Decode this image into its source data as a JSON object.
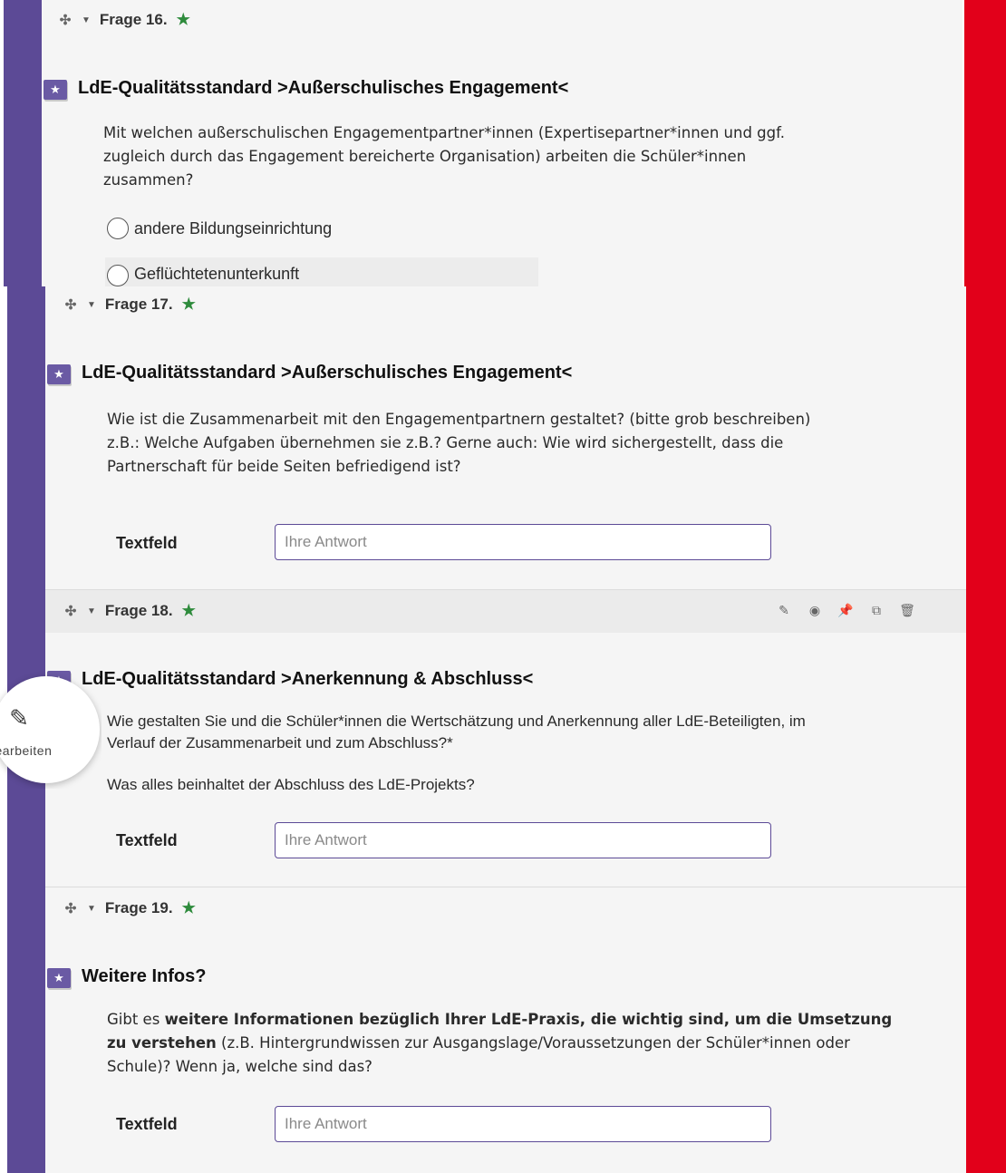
{
  "colors": {
    "left_stripe": "#5c4a96",
    "right_stripe": "#e2001a",
    "accent_star": "#2e8b3c",
    "badge": "#6a5aa4"
  },
  "questions": {
    "q16": {
      "header": "Frage 16.",
      "title": "LdE-Qualitätsstandard >Außerschulisches Engagement<",
      "text_lines": [
        "Mit welchen außerschulischen Engagementpartner*innen (Expertisepartner*innen und ggf.",
        "zugleich durch das Engagement bereicherte Organisation) arbeiten die Schüler*innen",
        "zusammen?"
      ],
      "options": [
        "andere Bildungseinrichtung",
        "Geflüchtetenunterkunft"
      ]
    },
    "q17": {
      "header": "Frage 17.",
      "title": "LdE-Qualitätsstandard >Außerschulisches Engagement<",
      "text_lines": [
        "Wie ist die Zusammenarbeit mit den Engagementpartnern gestaltet? (bitte grob beschreiben)",
        "z.B.: Welche Aufgaben übernehmen sie z.B.? Gerne auch: Wie wird sichergestellt, dass die",
        "Partnerschaft für beide Seiten befriedigend ist?"
      ],
      "field_label": "Textfeld",
      "placeholder": "Ihre Antwort"
    },
    "q18": {
      "header": "Frage 18.",
      "title": "LdE-Qualitätsstandard >Anerkennung & Abschluss<",
      "text_lines": [
        "Wie gestalten Sie und die Schüler*innen die Wertschätzung und Anerkennung aller LdE-Beteiligten, im",
        "Verlauf der Zusammenarbeit und zum Abschluss?*"
      ],
      "text_line_2": "Was alles beinhaltet der Abschluss des LdE-Projekts?",
      "field_label": "Textfeld",
      "placeholder": "Ihre Antwort",
      "toolbar": [
        "pencil-icon",
        "eye-icon",
        "pin-icon",
        "copy-icon",
        "trash-icon"
      ]
    },
    "q19": {
      "header": "Frage 19.",
      "title": "Weitere Infos?",
      "text_pre": "Gibt es ",
      "text_bold_1": "weitere Informationen bezüglich Ihrer LdE-Praxis, die wichtig sind, um die Umsetzung",
      "text_bold_2": "zu verstehen",
      "text_rest_1": " (z.B. Hintergrundwissen zur Ausgangslage/Voraussetzungen der Schüler*innen oder",
      "text_rest_2": "Schule)? Wenn ja, welche sind das?",
      "field_label": "Textfeld",
      "placeholder": "Ihre Antwort"
    }
  },
  "edit_fab": {
    "label": "Bearbeiten"
  }
}
